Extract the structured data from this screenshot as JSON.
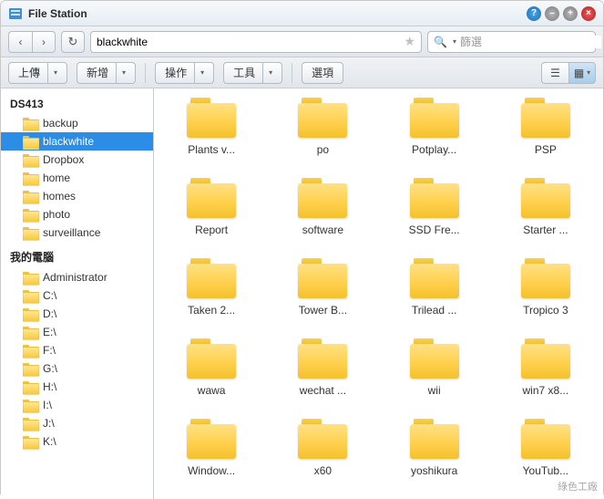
{
  "app": {
    "title": "File Station"
  },
  "nav": {
    "path_value": "blackwhite",
    "search_placeholder": "篩選"
  },
  "toolbar": {
    "upload": "上傳",
    "new": "新增",
    "action": "操作",
    "tools": "工具",
    "options": "選項"
  },
  "sidebar": {
    "root": "DS413",
    "shares": [
      {
        "label": "backup",
        "selected": false
      },
      {
        "label": "blackwhite",
        "selected": true
      },
      {
        "label": "Dropbox",
        "selected": false
      },
      {
        "label": "home",
        "selected": false
      },
      {
        "label": "homes",
        "selected": false
      },
      {
        "label": "photo",
        "selected": false
      },
      {
        "label": "surveillance",
        "selected": false
      }
    ],
    "computer_label": "我的電腦",
    "drives": [
      {
        "label": "Administrator"
      },
      {
        "label": "C:\\"
      },
      {
        "label": "D:\\"
      },
      {
        "label": "E:\\"
      },
      {
        "label": "F:\\"
      },
      {
        "label": "G:\\"
      },
      {
        "label": "H:\\"
      },
      {
        "label": "I:\\"
      },
      {
        "label": "J:\\"
      },
      {
        "label": "K:\\"
      }
    ]
  },
  "files": [
    {
      "label": "Plants v..."
    },
    {
      "label": "po"
    },
    {
      "label": "Potplay..."
    },
    {
      "label": "PSP"
    },
    {
      "label": "Report"
    },
    {
      "label": "software"
    },
    {
      "label": "SSD Fre..."
    },
    {
      "label": "Starter ..."
    },
    {
      "label": "Taken 2..."
    },
    {
      "label": "Tower B..."
    },
    {
      "label": "Trilead ..."
    },
    {
      "label": "Tropico 3"
    },
    {
      "label": "wawa"
    },
    {
      "label": "wechat ..."
    },
    {
      "label": "wii"
    },
    {
      "label": "win7 x8..."
    },
    {
      "label": "Window..."
    },
    {
      "label": "x60"
    },
    {
      "label": "yoshikura"
    },
    {
      "label": "YouTub..."
    }
  ],
  "watermark": "綠色工廠"
}
